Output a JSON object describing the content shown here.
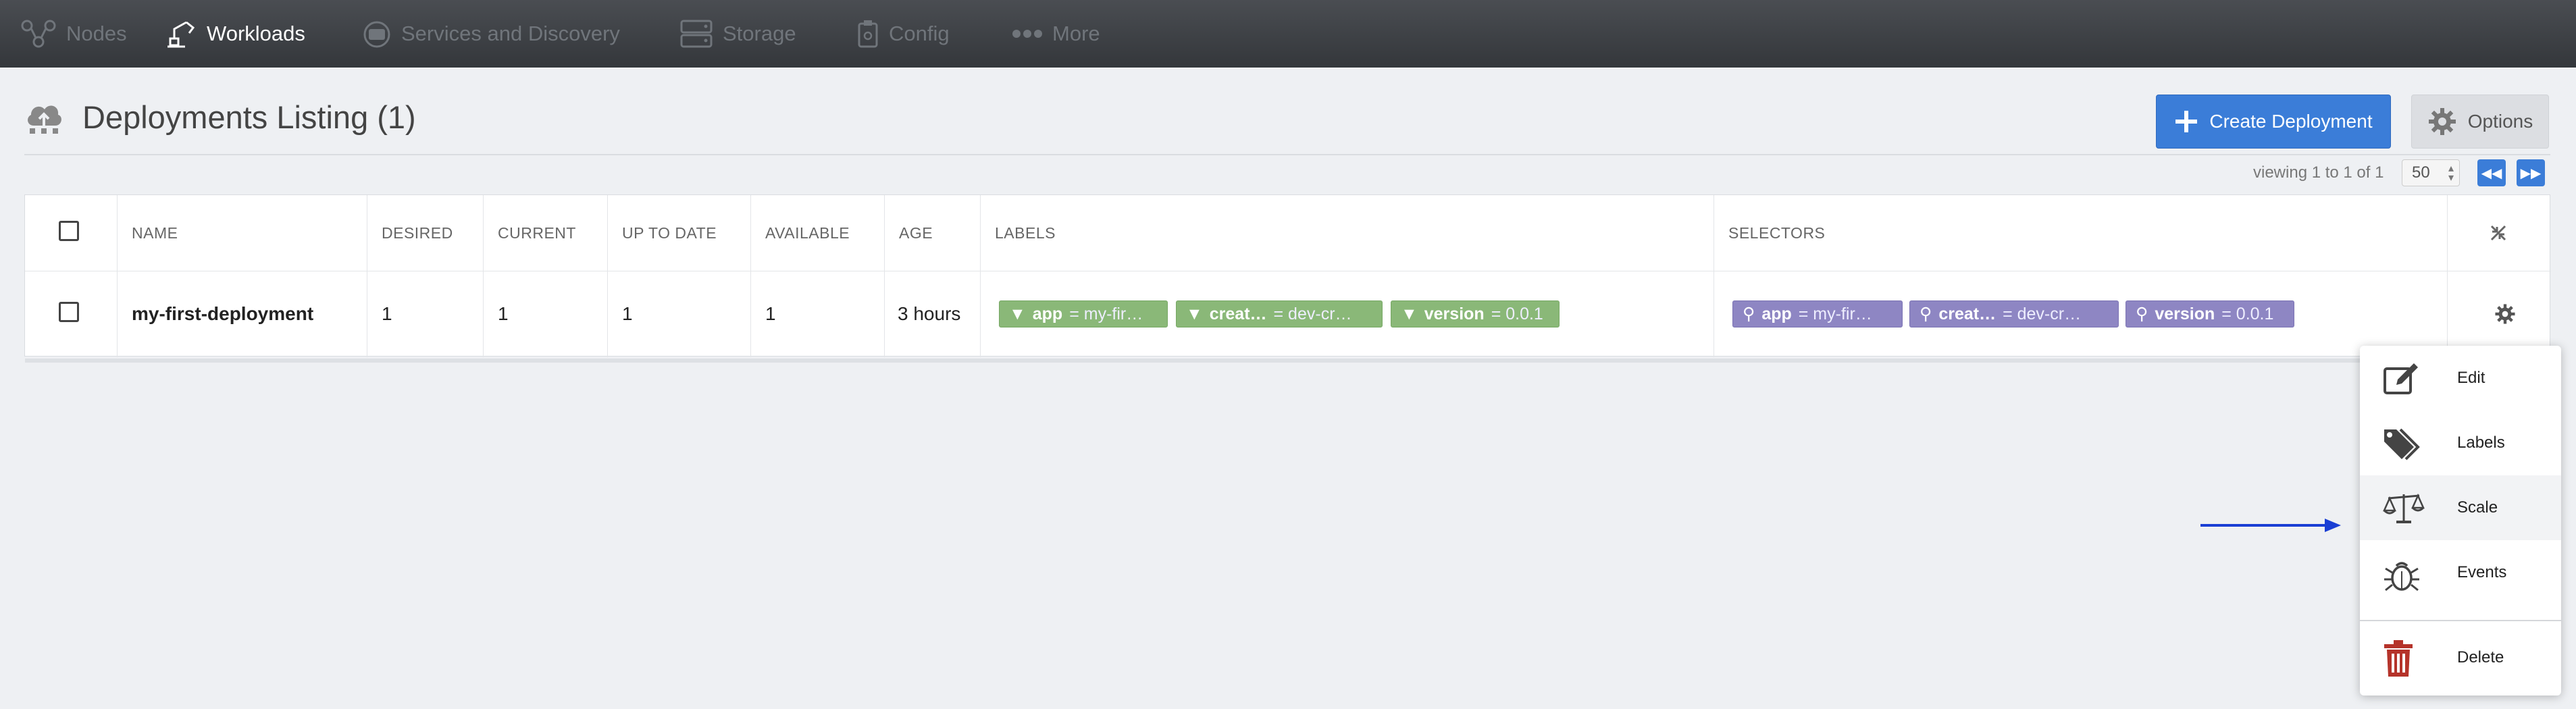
{
  "nav": {
    "items": [
      {
        "label": "Nodes",
        "icon": "nodes-icon"
      },
      {
        "label": "Workloads",
        "icon": "workloads-icon"
      },
      {
        "label": "Services and Discovery",
        "icon": "services-icon"
      },
      {
        "label": "Storage",
        "icon": "storage-icon"
      },
      {
        "label": "Config",
        "icon": "config-icon"
      },
      {
        "label": "More",
        "icon": "more-icon"
      }
    ],
    "active": "Workloads"
  },
  "header": {
    "title": "Deployments Listing (1)",
    "create_label": "Create Deployment",
    "options_label": "Options"
  },
  "pagination": {
    "viewing": "viewing 1 to 1 of 1",
    "per_page": "50"
  },
  "table": {
    "columns": [
      "NAME",
      "DESIRED",
      "CURRENT",
      "UP TO DATE",
      "AVAILABLE",
      "AGE",
      "LABELS",
      "SELECTORS"
    ],
    "rows": [
      {
        "name": "my-first-deployment",
        "desired": "1",
        "current": "1",
        "up_to_date": "1",
        "available": "1",
        "age": "3 hours",
        "labels": [
          {
            "key": "app",
            "value": "= my-fir…"
          },
          {
            "key": "creat…",
            "value": "= dev-cr…"
          },
          {
            "key": "version",
            "value": "= 0.0.1"
          }
        ],
        "selectors": [
          {
            "key": "app",
            "value": "= my-fir…"
          },
          {
            "key": "creat…",
            "value": "= dev-cr…"
          },
          {
            "key": "version",
            "value": "= 0.0.1"
          }
        ]
      }
    ]
  },
  "menu": {
    "items": [
      "Edit",
      "Labels",
      "Scale",
      "Events",
      "Delete"
    ],
    "highlighted": "Scale"
  },
  "colors": {
    "accent": "#3b7dd8",
    "label_tag": "#8ab878",
    "selector_tag": "#8e86c3",
    "delete_icon": "#b5332a",
    "annotation_arrow": "#1a3fd4"
  }
}
